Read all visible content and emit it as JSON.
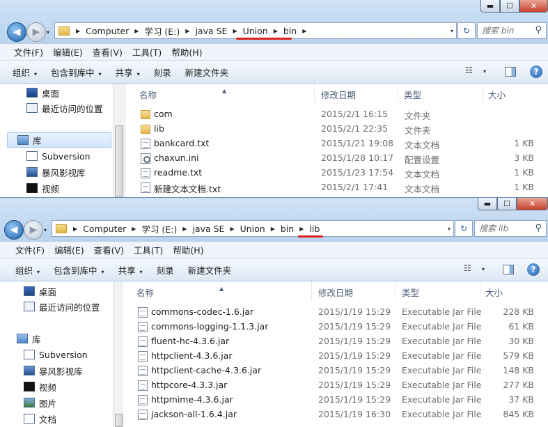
{
  "window_controls": {
    "minimize": "▬",
    "maximize": "☐",
    "close": "✕"
  },
  "nav": {
    "back": "◀",
    "forward": "▶",
    "dropdown": "▾"
  },
  "menu": [
    "文件(F)",
    "编辑(E)",
    "查看(V)",
    "工具(T)",
    "帮助(H)"
  ],
  "commands": {
    "organize": "组织",
    "include_in_library": "包含到库中",
    "share": "共享",
    "burn": "刻录",
    "new_folder": "新建文件夹"
  },
  "columns": {
    "name": "名称",
    "modified": "修改日期",
    "type": "类型",
    "size": "大小"
  },
  "icons": {
    "help": "?",
    "refresh": "↻",
    "search": "⚲",
    "views": "☷",
    "sort_arrow": "▲",
    "separator": "▶"
  },
  "annotation_color": "#e0201c",
  "window1": {
    "breadcrumb": [
      "Computer",
      "学习 (E:)",
      "java SE",
      "Union",
      "bin"
    ],
    "search_placeholder": "搜索 bin",
    "nav_pane": {
      "desktop": "桌面",
      "recent": "最近访问的位置",
      "library": "库",
      "subversion": "Subversion",
      "baofeng": "暴风影视库",
      "videos": "视频"
    },
    "files": [
      {
        "name": "com",
        "modified": "2015/2/1 16:15",
        "type": "文件夹",
        "size": "",
        "icon": "folder-icon"
      },
      {
        "name": "lib",
        "modified": "2015/2/1 22:35",
        "type": "文件夹",
        "size": "",
        "icon": "folder-icon"
      },
      {
        "name": "bankcard.txt",
        "modified": "2015/1/21 19:08",
        "type": "文本文档",
        "size": "1 KB",
        "icon": "text-file-icon"
      },
      {
        "name": "chaxun.ini",
        "modified": "2015/1/28 10:17",
        "type": "配置设置",
        "size": "3 KB",
        "icon": "ini-file-icon"
      },
      {
        "name": "readme.txt",
        "modified": "2015/1/23 17:54",
        "type": "文本文档",
        "size": "1 KB",
        "icon": "text-file-icon"
      },
      {
        "name": "新建文本文档.txt",
        "modified": "2015/2/1 17:41",
        "type": "文本文档",
        "size": "1 KB",
        "icon": "text-file-icon"
      }
    ]
  },
  "window2": {
    "breadcrumb": [
      "Computer",
      "学习 (E:)",
      "java SE",
      "Union",
      "bin",
      "lib"
    ],
    "search_placeholder": "搜索 lib",
    "nav_pane": {
      "desktop": "桌面",
      "recent": "最近访问的位置",
      "library": "库",
      "subversion": "Subversion",
      "baofeng": "暴风影视库",
      "videos": "视频",
      "pictures": "图片",
      "documents": "文档"
    },
    "files": [
      {
        "name": "commons-codec-1.6.jar",
        "modified": "2015/1/19 15:29",
        "type": "Executable Jar File",
        "size": "228 KB",
        "icon": "jar-file-icon"
      },
      {
        "name": "commons-logging-1.1.3.jar",
        "modified": "2015/1/19 15:29",
        "type": "Executable Jar File",
        "size": "61 KB",
        "icon": "jar-file-icon"
      },
      {
        "name": "fluent-hc-4.3.6.jar",
        "modified": "2015/1/19 15:29",
        "type": "Executable Jar File",
        "size": "30 KB",
        "icon": "jar-file-icon"
      },
      {
        "name": "httpclient-4.3.6.jar",
        "modified": "2015/1/19 15:29",
        "type": "Executable Jar File",
        "size": "579 KB",
        "icon": "jar-file-icon"
      },
      {
        "name": "httpclient-cache-4.3.6.jar",
        "modified": "2015/1/19 15:29",
        "type": "Executable Jar File",
        "size": "148 KB",
        "icon": "jar-file-icon"
      },
      {
        "name": "httpcore-4.3.3.jar",
        "modified": "2015/1/19 15:29",
        "type": "Executable Jar File",
        "size": "277 KB",
        "icon": "jar-file-icon"
      },
      {
        "name": "httpmime-4.3.6.jar",
        "modified": "2015/1/19 15:29",
        "type": "Executable Jar File",
        "size": "37 KB",
        "icon": "jar-file-icon"
      },
      {
        "name": "jackson-all-1.6.4.jar",
        "modified": "2015/1/19 16:30",
        "type": "Executable Jar File",
        "size": "845 KB",
        "icon": "jar-file-icon"
      }
    ]
  }
}
